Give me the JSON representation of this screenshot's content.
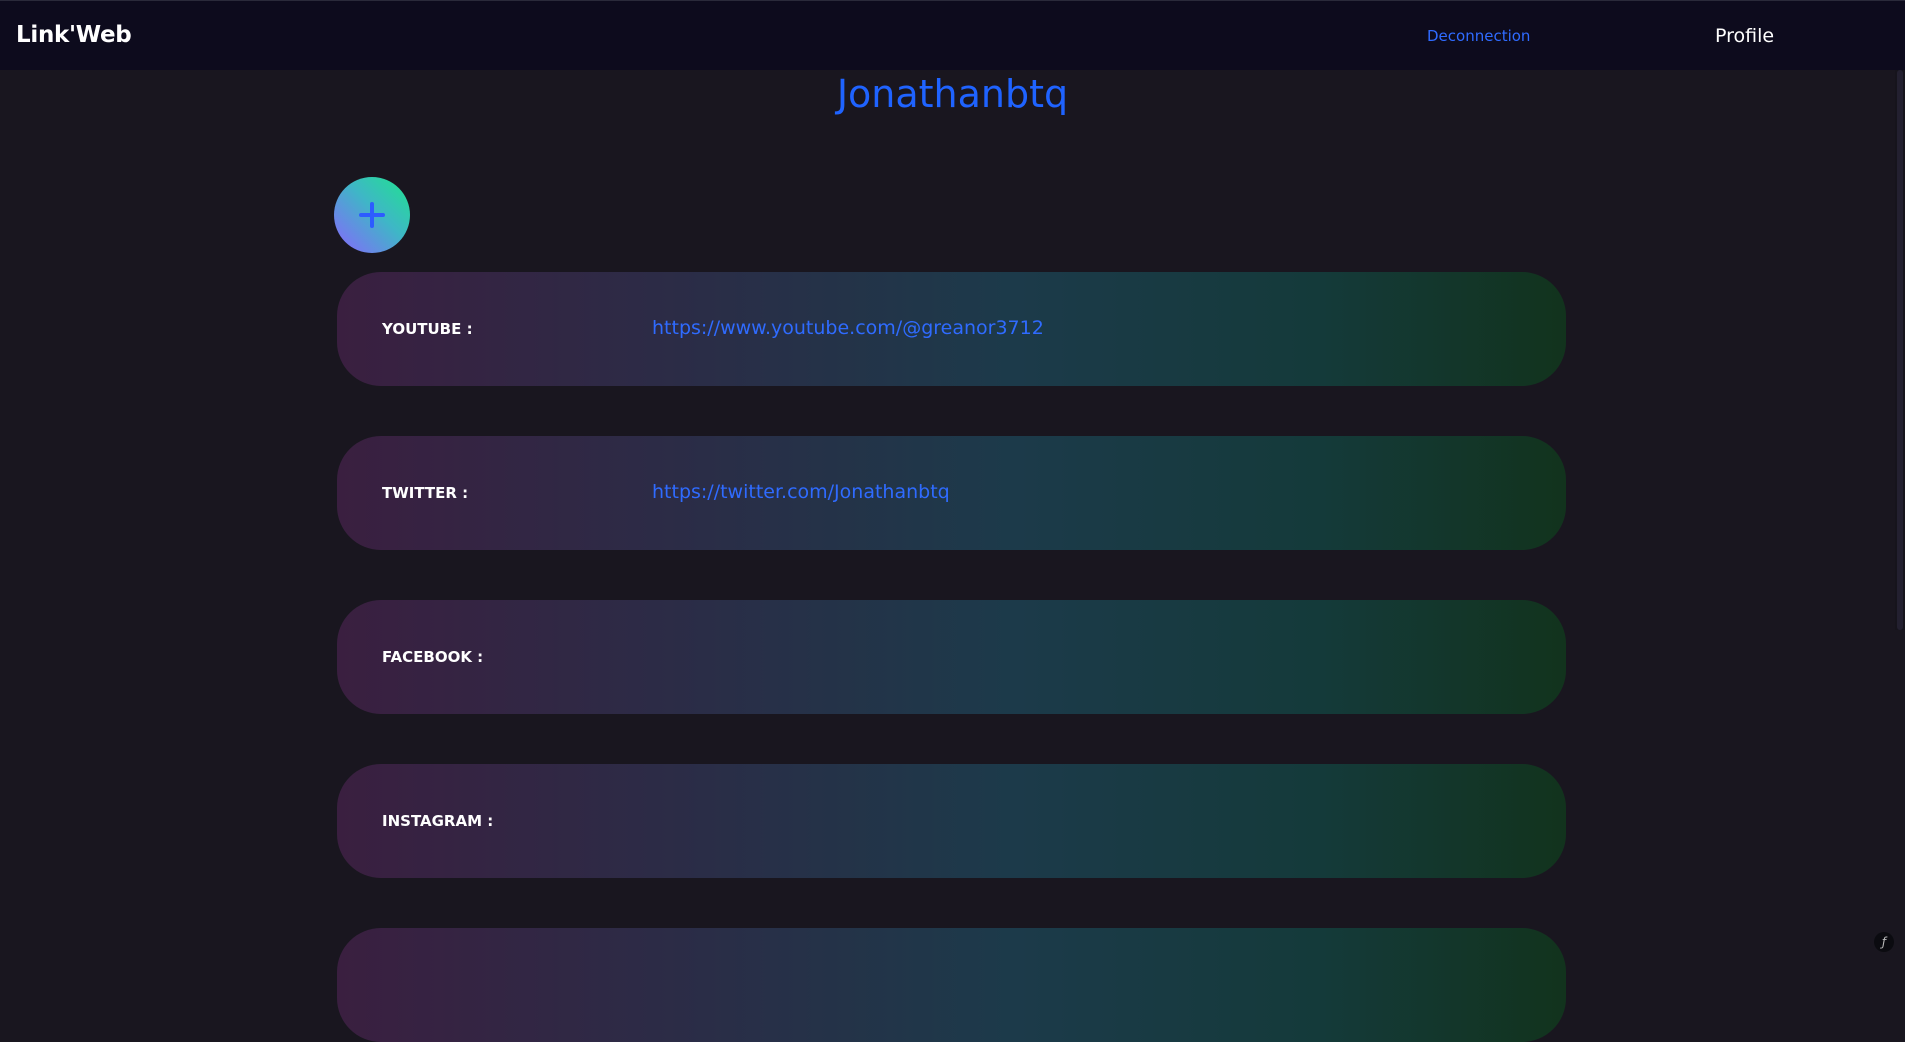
{
  "navbar": {
    "brand": "Link'Web",
    "logout_label": "Deconnection",
    "profile_label": "Profile"
  },
  "username": "Jonathanbtq",
  "add_button": {
    "icon": "plus-icon",
    "symbol": "+"
  },
  "links": [
    {
      "label": "YOUTUBE :",
      "url": "https://www.youtube.com/@greanor3712"
    },
    {
      "label": "TWITTER :",
      "url": "https://twitter.com/Jonathanbtq"
    },
    {
      "label": "FACEBOOK :",
      "url": ""
    },
    {
      "label": "INSTAGRAM :",
      "url": ""
    }
  ],
  "colors": {
    "background": "#19161f",
    "navbar": "#0d0b1d",
    "accent_blue": "#1f63ff"
  }
}
